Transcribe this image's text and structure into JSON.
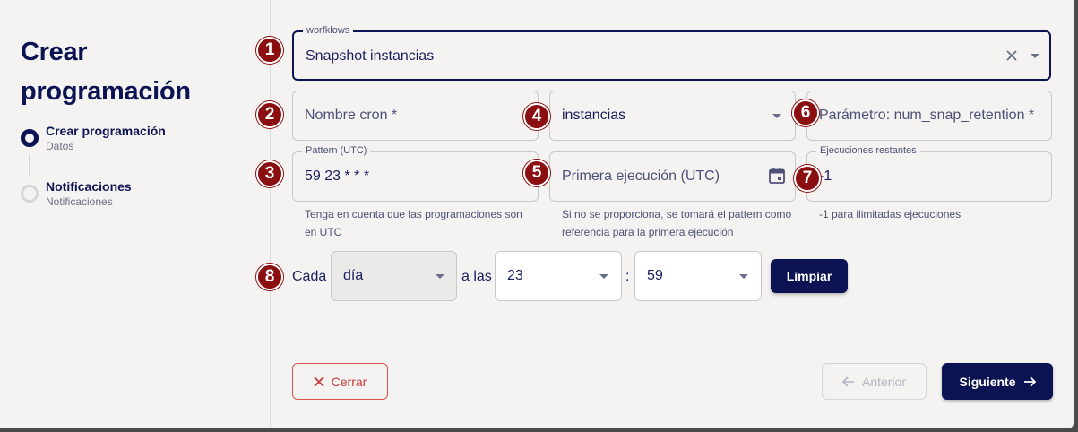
{
  "sidebar": {
    "title": "Crear programación",
    "steps": [
      {
        "label": "Crear programación",
        "sub": "Datos",
        "state": "active"
      },
      {
        "label": "Notificaciones",
        "sub": "Notificaciones",
        "state": "inactive"
      }
    ]
  },
  "form": {
    "workflows": {
      "legend": "worfklows",
      "value": "Snapshot instancias"
    },
    "nombre_cron": {
      "placeholder": "Nombre cron *"
    },
    "instancias": {
      "value": "instancias"
    },
    "parametro": {
      "placeholder": "Parámetro: num_snap_retention *"
    },
    "pattern": {
      "legend": "Pattern (UTC)",
      "value": "59 23 * * *",
      "helper": "Tenga en cuenta que las programaciones son en UTC"
    },
    "primera": {
      "placeholder": "Primera ejecución (UTC)",
      "helper": "Si no se proporciona, se tomará el pattern como referencia para la primera ejecución"
    },
    "ejecuciones": {
      "legend": "Ejecuciones restantes",
      "value": "-1",
      "helper": "-1 para ilimitadas ejecuciones"
    },
    "cada_label": "Cada",
    "frecuencia": {
      "value": "día"
    },
    "a_las_label": "a las",
    "hora": {
      "value": "23"
    },
    "separator": ":",
    "minuto": {
      "value": "59"
    },
    "limpiar_label": "Limpiar"
  },
  "badges": [
    "1",
    "2",
    "3",
    "4",
    "5",
    "6",
    "7",
    "8"
  ],
  "footer": {
    "cerrar_label": "Cerrar",
    "anterior_label": "Anterior",
    "siguiente_label": "Siguiente"
  },
  "colors": {
    "primary": "#0b1352",
    "badge": "#8b0e10",
    "danger": "#c73a36"
  }
}
